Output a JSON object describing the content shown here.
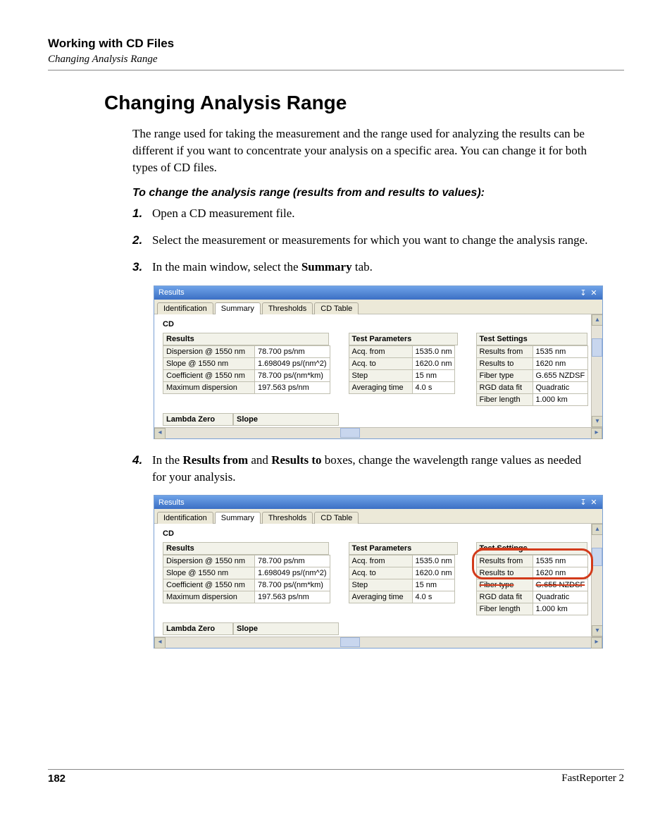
{
  "header": {
    "title": "Working with CD Files",
    "subtitle": "Changing Analysis Range"
  },
  "section": {
    "title": "Changing Analysis Range",
    "intro": "The range used for taking the measurement and the range used for analyzing the results can be different if you want to concentrate your analysis on a specific area. You can change it for both types of CD files.",
    "subhead": "To change the analysis range (results from and results to values):",
    "steps": [
      {
        "n": "1.",
        "text_a": "Open a CD measurement file.",
        "bold": "",
        "text_b": ""
      },
      {
        "n": "2.",
        "text_a": "Select the measurement or measurements for which you want to change the analysis range.",
        "bold": "",
        "text_b": ""
      },
      {
        "n": "3.",
        "text_a": "In the main window, select the ",
        "bold": "Summary",
        "text_b": " tab."
      },
      {
        "n": "4.",
        "text_a": "In the ",
        "bold": "Results from",
        "mid": " and ",
        "bold2": "Results to",
        "text_b": " boxes, change the wavelength range values as needed for your analysis."
      }
    ]
  },
  "panel": {
    "title": "Results",
    "tabs": [
      "Identification",
      "Summary",
      "Thresholds",
      "CD Table"
    ],
    "active_tab": 1,
    "cd_label": "CD",
    "groups": {
      "results_head": "Results",
      "results": [
        [
          "Dispersion @ 1550 nm",
          "78.700 ps/nm"
        ],
        [
          "Slope @ 1550 nm",
          "1.698049 ps/(nm^2)"
        ],
        [
          "Coefficient @ 1550 nm",
          "78.700 ps/(nm*km)"
        ],
        [
          "Maximum dispersion",
          "197.563 ps/nm"
        ]
      ],
      "testparams_head": "Test Parameters",
      "testparams": [
        [
          "Acq. from",
          "1535.0 nm"
        ],
        [
          "Acq. to",
          "1620.0 nm"
        ],
        [
          "Step",
          "15 nm"
        ],
        [
          "Averaging time",
          "4.0 s"
        ]
      ],
      "testsettings_head": "Test Settings",
      "testsettings": [
        [
          "Results from",
          "1535 nm"
        ],
        [
          "Results to",
          "1620 nm"
        ],
        [
          "Fiber type",
          "G.655 NZDSF"
        ],
        [
          "RGD data fit",
          "Quadratic"
        ],
        [
          "Fiber length",
          "1.000 km"
        ]
      ],
      "lambda_head": "Lambda Zero",
      "slope_head": "Slope"
    }
  },
  "footer": {
    "page": "182",
    "product": "FastReporter 2"
  }
}
